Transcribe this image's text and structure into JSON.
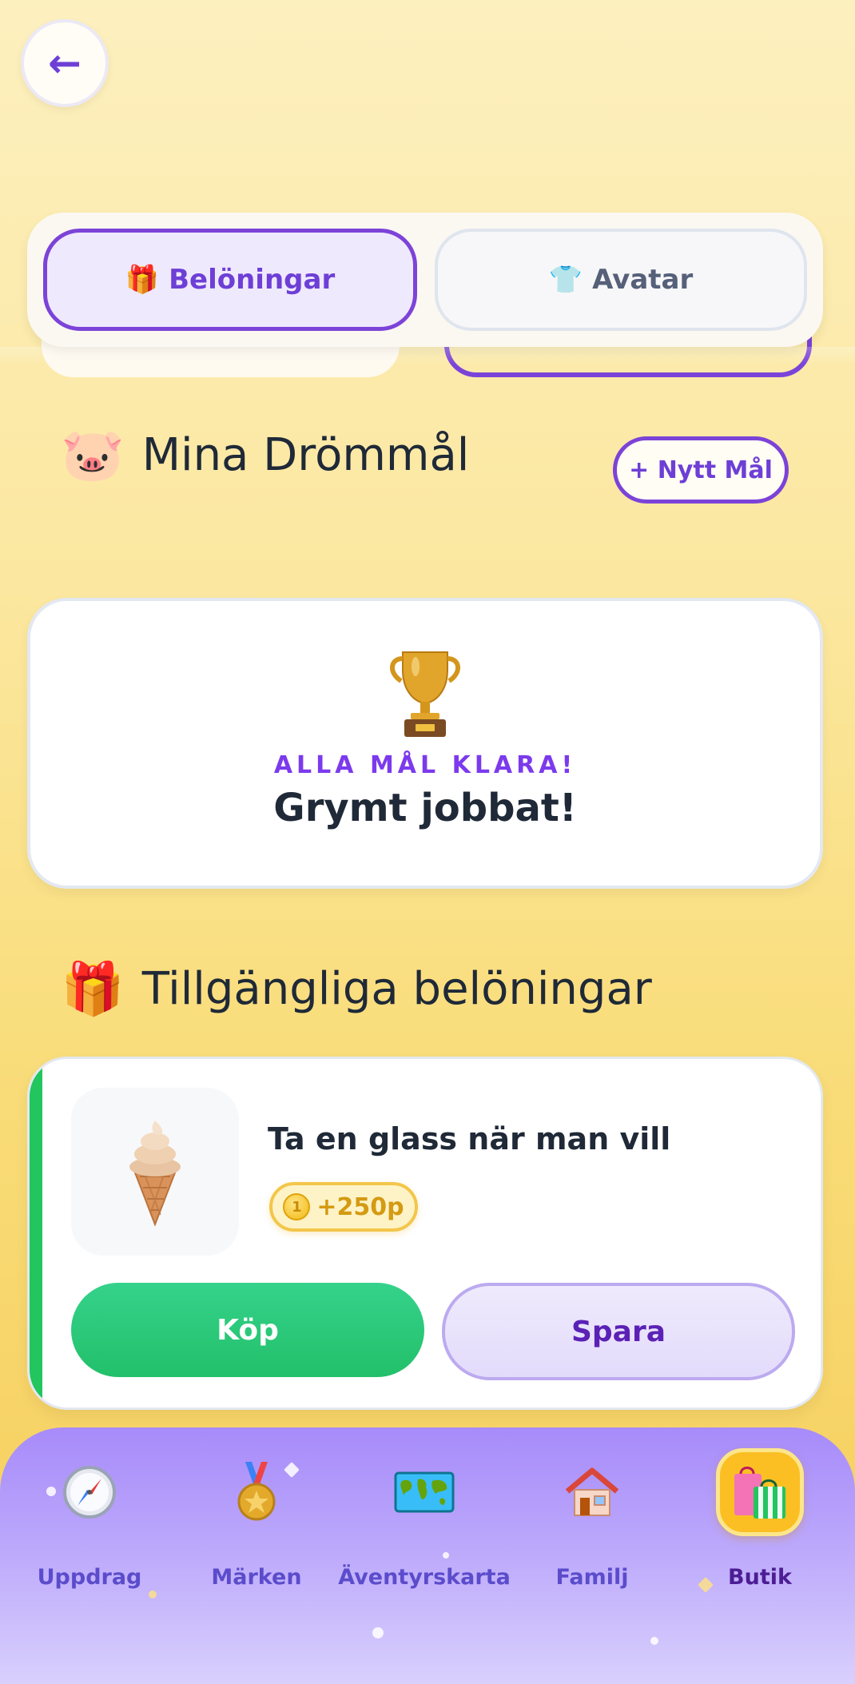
{
  "header": {
    "back_icon": "←"
  },
  "tabs": [
    {
      "icon": "🎁",
      "label": "Belöningar",
      "active": true
    },
    {
      "icon": "👕",
      "label": "Avatar",
      "active": false
    }
  ],
  "goals": {
    "icon": "🐷",
    "title": "Mina Drömmål",
    "new_goal_label": "+ Nytt Mål",
    "done_card": {
      "kicker": "ALLA MÅL KLARA!",
      "title": "Grymt jobbat!"
    }
  },
  "rewards": {
    "icon": "🎁",
    "title": "Tillgängliga belöningar",
    "items": [
      {
        "name": "Ta en glass när man vill",
        "price": "+250p",
        "buy_label": "Köp",
        "save_label": "Spara",
        "accent": "#22c55e"
      }
    ]
  },
  "nav": [
    {
      "label": "Uppdrag",
      "icon": "compass-icon",
      "active": false
    },
    {
      "label": "Märken",
      "icon": "medal-icon",
      "active": false
    },
    {
      "label": "Äventyrskarta",
      "icon": "world-map-icon",
      "active": false
    },
    {
      "label": "Familj",
      "icon": "house-icon",
      "active": false
    },
    {
      "label": "Butik",
      "icon": "shopping-bags-icon",
      "active": true
    }
  ],
  "colors": {
    "accent": "#7c43d8",
    "buy": "#22c55e",
    "coin": "#f2b90f",
    "nav_bg": "#a78bfa"
  }
}
